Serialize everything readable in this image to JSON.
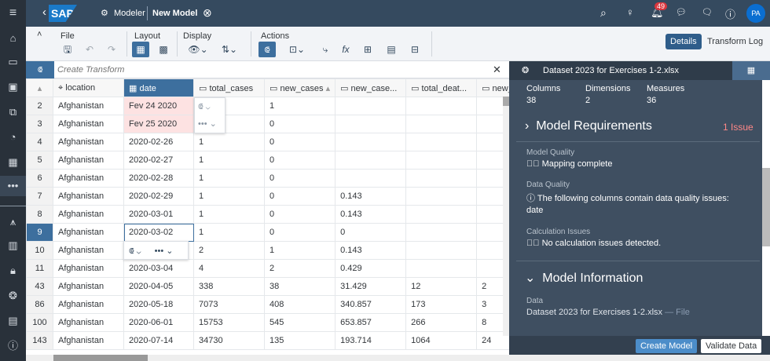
{
  "topbar": {
    "app": "Modeler",
    "title": "New Model",
    "logo": "SAP",
    "notifications": "49",
    "avatar": "PA"
  },
  "toolbar": {
    "groups": {
      "file": "File",
      "layout": "Layout",
      "display": "Display",
      "actions": "Actions"
    },
    "details": "Details",
    "transform_log": "Transform Log"
  },
  "transform": {
    "placeholder": "Create Transform"
  },
  "table": {
    "headers": [
      "location",
      "date",
      "total_cases",
      "new_cases",
      "new_case...",
      "total_deat...",
      "new_"
    ],
    "rows": [
      [
        "2",
        "Afghanistan",
        "Fev 24 2020",
        "",
        "1",
        "",
        "",
        ""
      ],
      [
        "3",
        "Afghanistan",
        "Fev 25 2020",
        "",
        "0",
        "",
        "",
        ""
      ],
      [
        "4",
        "Afghanistan",
        "2020-02-26",
        "1",
        "0",
        "",
        "",
        ""
      ],
      [
        "5",
        "Afghanistan",
        "2020-02-27",
        "1",
        "0",
        "",
        "",
        ""
      ],
      [
        "6",
        "Afghanistan",
        "2020-02-28",
        "1",
        "0",
        "",
        "",
        ""
      ],
      [
        "7",
        "Afghanistan",
        "2020-02-29",
        "1",
        "0",
        "0.143",
        "",
        ""
      ],
      [
        "8",
        "Afghanistan",
        "2020-03-01",
        "1",
        "0",
        "0.143",
        "",
        ""
      ],
      [
        "9",
        "Afghanistan",
        "2020-03-02",
        "1",
        "0",
        "0",
        "",
        ""
      ],
      [
        "10",
        "Afghanistan",
        "",
        "2",
        "1",
        "0.143",
        "",
        ""
      ],
      [
        "11",
        "Afghanistan",
        "2020-03-04",
        "4",
        "2",
        "0.429",
        "",
        ""
      ],
      [
        "43",
        "Afghanistan",
        "2020-04-05",
        "338",
        "38",
        "31.429",
        "12",
        "2"
      ],
      [
        "86",
        "Afghanistan",
        "2020-05-18",
        "7073",
        "408",
        "340.857",
        "173",
        "3"
      ],
      [
        "100",
        "Afghanistan",
        "2020-06-01",
        "15753",
        "545",
        "653.857",
        "266",
        "8"
      ],
      [
        "143",
        "Afghanistan",
        "2020-07-14",
        "34730",
        "135",
        "193.714",
        "1064",
        "24"
      ]
    ]
  },
  "panel": {
    "dataset": "Dataset 2023 for Exercises 1-2.xlsx",
    "stats": [
      {
        "label": "Columns",
        "value": "38"
      },
      {
        "label": "Dimensions",
        "value": "2"
      },
      {
        "label": "Measures",
        "value": "36"
      }
    ],
    "requirements": {
      "title": "Model Requirements",
      "issues": "1 Issue",
      "model_quality_label": "Model Quality",
      "model_quality": "Mapping complete",
      "data_quality_label": "Data Quality",
      "data_quality": "The following columns contain data quality issues:",
      "data_quality_cols": "date",
      "calc_label": "Calculation Issues",
      "calc": "No calculation issues detected."
    },
    "info": {
      "title": "Model Information",
      "data_label": "Data",
      "data_value": "Dataset 2023 for Exercises 1-2.xlsx",
      "data_type": "— File"
    },
    "create": "Create Model",
    "validate": "Validate Data"
  },
  "colors": {
    "accent": "#3d6f9e",
    "shell": "#354a5f",
    "panel": "#3f4f61",
    "issue": "#ff8888",
    "error_cell": "#fde2e2"
  }
}
